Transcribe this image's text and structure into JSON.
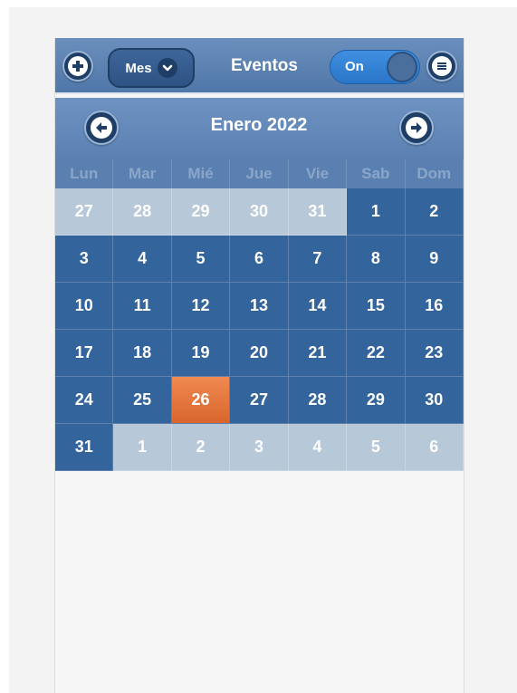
{
  "toolbar": {
    "view_label": "Mes",
    "title": "Eventos",
    "toggle_label": "On",
    "icons": {
      "add": "plus-icon",
      "view": "chevron-down-icon",
      "menu": "menu-icon"
    }
  },
  "calendar": {
    "month_title": "Enero 2022",
    "prev_icon": "arrow-left-icon",
    "next_icon": "arrow-right-icon",
    "weekdays": [
      "Lun",
      "Mar",
      "Mié",
      "Jue",
      "Vie",
      "Sab",
      "Dom"
    ],
    "today": "26",
    "days": [
      {
        "label": "27",
        "state": "other"
      },
      {
        "label": "28",
        "state": "other"
      },
      {
        "label": "29",
        "state": "other"
      },
      {
        "label": "30",
        "state": "other"
      },
      {
        "label": "31",
        "state": "other"
      },
      {
        "label": "1",
        "state": "cur"
      },
      {
        "label": "2",
        "state": "cur"
      },
      {
        "label": "3",
        "state": "cur"
      },
      {
        "label": "4",
        "state": "cur"
      },
      {
        "label": "5",
        "state": "cur"
      },
      {
        "label": "6",
        "state": "cur"
      },
      {
        "label": "7",
        "state": "cur"
      },
      {
        "label": "8",
        "state": "cur"
      },
      {
        "label": "9",
        "state": "cur"
      },
      {
        "label": "10",
        "state": "cur"
      },
      {
        "label": "11",
        "state": "cur"
      },
      {
        "label": "12",
        "state": "cur"
      },
      {
        "label": "13",
        "state": "cur"
      },
      {
        "label": "14",
        "state": "cur"
      },
      {
        "label": "15",
        "state": "cur"
      },
      {
        "label": "16",
        "state": "cur"
      },
      {
        "label": "17",
        "state": "cur"
      },
      {
        "label": "18",
        "state": "cur"
      },
      {
        "label": "19",
        "state": "cur"
      },
      {
        "label": "20",
        "state": "cur"
      },
      {
        "label": "21",
        "state": "cur"
      },
      {
        "label": "22",
        "state": "cur"
      },
      {
        "label": "23",
        "state": "cur"
      },
      {
        "label": "24",
        "state": "cur"
      },
      {
        "label": "25",
        "state": "cur"
      },
      {
        "label": "26",
        "state": "today"
      },
      {
        "label": "27",
        "state": "cur"
      },
      {
        "label": "28",
        "state": "cur"
      },
      {
        "label": "29",
        "state": "cur"
      },
      {
        "label": "30",
        "state": "cur"
      },
      {
        "label": "31",
        "state": "cur"
      },
      {
        "label": "1",
        "state": "other"
      },
      {
        "label": "2",
        "state": "other"
      },
      {
        "label": "3",
        "state": "other"
      },
      {
        "label": "4",
        "state": "other"
      },
      {
        "label": "5",
        "state": "other"
      },
      {
        "label": "6",
        "state": "other"
      }
    ]
  },
  "colors": {
    "toolbar": "#5a80b2",
    "current_day": "#33649b",
    "other_month_day": "#b7c8d9",
    "today": "#e5753c",
    "toggle_on": "#3483d6"
  }
}
